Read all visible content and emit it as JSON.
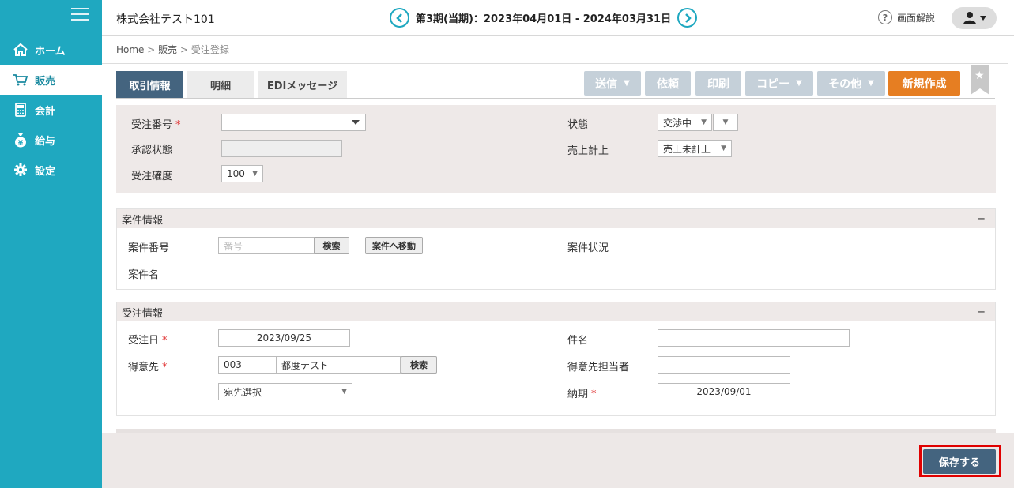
{
  "header": {
    "company": "株式会社テスト101",
    "period": "第3期(当期)：2023年04月01日 - 2024年03月31日",
    "help_label": "画面解説"
  },
  "sidebar": {
    "items": [
      {
        "label": "ホーム",
        "icon": "home-icon"
      },
      {
        "label": "販売",
        "icon": "cart-icon"
      },
      {
        "label": "会計",
        "icon": "calculator-icon"
      },
      {
        "label": "給与",
        "icon": "money-bag-icon"
      },
      {
        "label": "設定",
        "icon": "gear-icon"
      }
    ]
  },
  "breadcrumb": {
    "home": "Home",
    "sales": "販売",
    "sep": ">",
    "current": "受注登録"
  },
  "tabs": [
    {
      "label": "取引情報"
    },
    {
      "label": "明細"
    },
    {
      "label": "EDIメッセージ"
    }
  ],
  "toolbar": {
    "send": "送信",
    "request": "依頼",
    "print": "印刷",
    "copy": "コピー",
    "other": "その他",
    "new": "新規作成"
  },
  "top_form": {
    "order_no_label": "受注番号",
    "approval_label": "承認状態",
    "accuracy_label": "受注確度",
    "accuracy_value": "100",
    "status_label": "状態",
    "status_value": "交渉中",
    "sales_label": "売上計上",
    "sales_value": "売上未計上"
  },
  "project": {
    "title": "案件情報",
    "collapse": "−",
    "no_label": "案件番号",
    "no_placeholder": "番号",
    "search": "検索",
    "move": "案件へ移動",
    "status_label": "案件状況",
    "name_label": "案件名"
  },
  "order": {
    "title": "受注情報",
    "collapse": "−",
    "date_label": "受注日",
    "date_value": "2023/09/25",
    "customer_label": "得意先",
    "customer_code": "003",
    "customer_name": "都度テスト",
    "search": "検索",
    "address_select": "宛先選択",
    "subject_label": "件名",
    "contact_label": "得意先担当者",
    "due_label": "納期",
    "due_value": "2023/09/01"
  },
  "footer": {
    "save": "保存する"
  },
  "required_mark": "*"
}
